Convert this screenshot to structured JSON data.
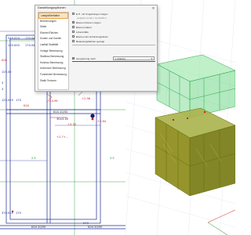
{
  "colors": {
    "structure_blue": "#1d2b8f",
    "dimension_red": "#d21f1f",
    "grid_green": "#138a2c",
    "volume_green": "#3cc85a",
    "soil_olive": "#8a8a14",
    "selection_red": "#d21f1f",
    "active_item": "#fbe3c0"
  },
  "plan": {
    "labels": {
      "t1": "545.020",
      "t2": "170.04",
      "t3": "125.000",
      "t4": "170.04",
      "t5": "K00",
      "t6": "125.00",
      "l1": "3",
      "l2": "3",
      "l3": "125.025",
      "l4": "170",
      "l5": "K04",
      "m1": "K04 20/50",
      "m2": "-14.96",
      "m3": "+2.96",
      "m4": "30x3.16",
      "m5": "+3.35",
      "m6": "+2.84",
      "m7": "+2.7+...",
      "g1": "2.5",
      "g2": "2.5",
      "b1": "370.015",
      "b2": "170",
      "b3": "K04 20/50",
      "b4": "572",
      "b5": "K04 20/50"
    }
  },
  "panel": {
    "title": "Darstellungsoptionen",
    "close_glyph": "✕",
    "nav_items": [
      "Lastgrößenfaktor",
      "Berechnungen",
      "Stäbe",
      "Ebenen/Flächen",
      "Knoten und Kanten",
      "Lastfall Stabilität",
      "Vorlage Bemessung",
      "Stahlbau Bemessung",
      "Holzbau Bemessung",
      "Aluminium Bemessung",
      "Fundament Bemessung",
      "Statik Texturen"
    ],
    "active_index": 0,
    "options": [
      {
        "label": "E.H. mit Umgebungen zeigen",
        "checked": false,
        "sub": false
      },
      {
        "label": "Aufgabe ändern auswählen",
        "checked": false,
        "sub": true
      },
      {
        "label": "Ebenen fixieren zeigen",
        "checked": true,
        "sub": false
      },
      {
        "label": "Ebenen klären",
        "checked": false,
        "sub": false
      },
      {
        "label": "Linienkräfte",
        "checked": false,
        "sub": false
      },
      {
        "label": "Ebenen als Umbindungslinien",
        "checked": false,
        "sub": false
      },
      {
        "label": "Belastungsflächen gezeigt",
        "checked": false,
        "sub": false
      },
      {
        "label": "Gruppierung nach",
        "checked": true,
        "sub": false
      }
    ],
    "check_glyph": "✓",
    "select_value": "1 (WENO)",
    "select_arrow": "▼"
  }
}
